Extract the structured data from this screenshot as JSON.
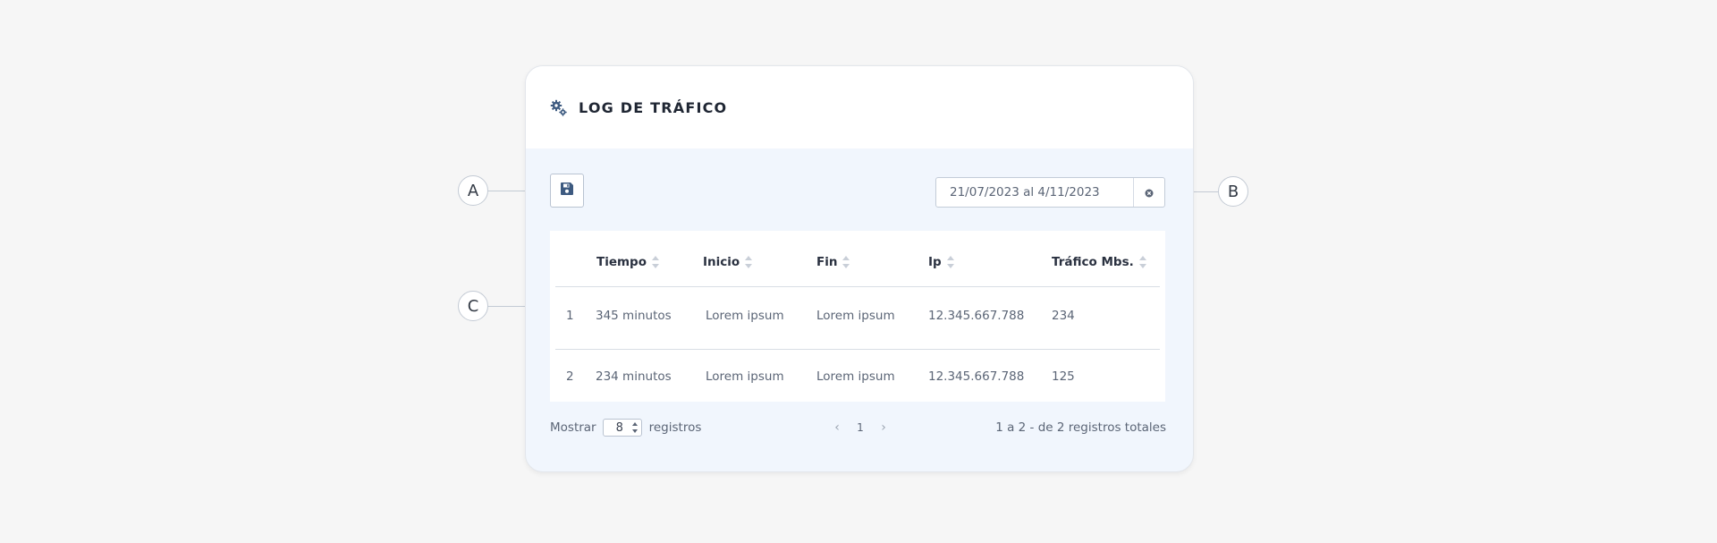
{
  "panel": {
    "title": "LOG DE TRÁFICO"
  },
  "toolbar": {
    "save_icon": "floppy-disk-icon",
    "date_range": "21/07/2023 al 4/11/2023",
    "clear_icon": "clear-circle-icon"
  },
  "table": {
    "columns": [
      "Tiempo",
      "Inicio",
      "Fin",
      "Ip",
      "Tráfico Mbs."
    ],
    "rows": [
      {
        "index": "1",
        "tiempo": "345 minutos",
        "inicio": "Lorem ipsum",
        "fin": "Lorem ipsum",
        "ip": "12.345.667.788",
        "trafico": "234"
      },
      {
        "index": "2",
        "tiempo": "234 minutos",
        "inicio": "Lorem ipsum",
        "fin": "Lorem ipsum",
        "ip": "12.345.667.788",
        "trafico": "125"
      }
    ]
  },
  "footer": {
    "show_label": "Mostrar",
    "page_size": "8",
    "records_label": "registros",
    "prev_icon": "chevron-left-icon",
    "current_page": "1",
    "next_icon": "chevron-right-icon",
    "summary": "1 a 2 - de 2 registros totales"
  },
  "callouts": {
    "a": "A",
    "b": "B",
    "c": "C"
  },
  "colors": {
    "accent": "#3d5a80",
    "panel_bg": "#f1f6fd"
  }
}
